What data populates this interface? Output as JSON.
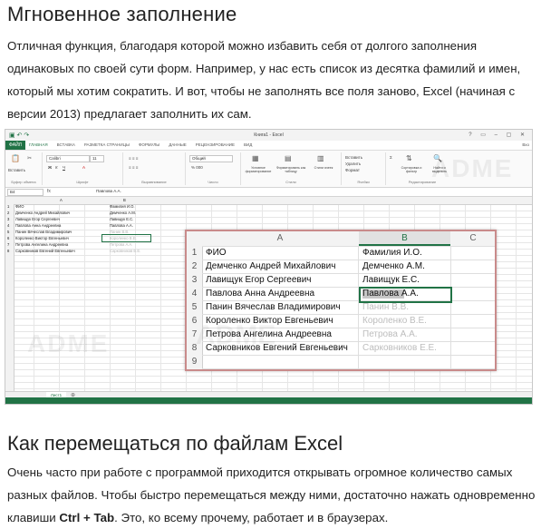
{
  "heading1": "Мгновенное заполнение",
  "para1": "Отличная функция, благодаря которой можно избавить себя от долгого заполнения одинаковых по своей сути форм. Например, у нас есть список из десятка фамилий и имен, который мы хотим сократить. И вот, чтобы не заполнять все поля заново, Excel (начиная с версии 2013) предлагает заполнить их сам.",
  "excel": {
    "window_title": "Книга1 - Excel",
    "file_tab": "ФАЙЛ",
    "tabs": [
      "ГЛАВНАЯ",
      "ВСТАВКА",
      "РАЗМЕТКА СТРАНИЦЫ",
      "ФОРМУЛЫ",
      "ДАННЫЕ",
      "РЕЦЕНЗИРОВАНИЕ",
      "ВИД"
    ],
    "user": "Вхо",
    "ribbon": {
      "paste": "Вставить",
      "font_name": "Calibri",
      "font_size": "11",
      "number_format": "Общий",
      "cond_format": "Условное форматирование",
      "format_table": "Форматировать как таблицу",
      "cell_styles": "Стили ячеек",
      "insert": "Вставить",
      "delete": "Удалить",
      "format": "Формат",
      "sort": "Сортировка и фильтр",
      "find": "Найти и выделить",
      "groups": [
        "Буфер обмена",
        "Шрифт",
        "Выравнивание",
        "Число",
        "Стили",
        "Ячейки",
        "Редактирование"
      ]
    },
    "name_box": "B4",
    "fx": "fx",
    "formula_value": "Павлова А.А.",
    "sheet_tab": "Лист1",
    "watermark": "ADME"
  },
  "table": {
    "col_a": "A",
    "col_b": "B",
    "col_c": "C",
    "rows": [
      {
        "n": "1",
        "a": "ФИО",
        "b": "Фамилия И.О.",
        "suggest": false
      },
      {
        "n": "2",
        "a": "Демченко Андрей Михайлович",
        "b": "Демченко А.М.",
        "suggest": false
      },
      {
        "n": "3",
        "a": "Лавищук Егор Сергеевич",
        "b": "Лавищук Е.С.",
        "suggest": false
      },
      {
        "n": "4",
        "a": "Павлова Анна Андреевна",
        "b": "Павлова А.А.",
        "suggest": false
      },
      {
        "n": "5",
        "a": "Панин Вячеслав Владимирович",
        "b": "Панин В.В.",
        "suggest": true
      },
      {
        "n": "6",
        "a": "Короленко Виктор Евгеньевич",
        "b": "Короленко В.Е.",
        "suggest": true
      },
      {
        "n": "7",
        "a": "Петрова Ангелина Андреевна",
        "b": "Петрова А.А.",
        "suggest": true
      },
      {
        "n": "8",
        "a": "Сарковников Евгений Евгеньевич",
        "b": "Сарковников Е.Е.",
        "suggest": true
      },
      {
        "n": "9",
        "a": "",
        "b": "",
        "suggest": false
      }
    ]
  },
  "heading2": "Как перемещаться по файлам Excel",
  "para2_start": "Очень часто при работе с программой приходится открывать огромное количество самых разных файлов. Чтобы быстро перемещаться между ними, достаточно нажать одновременно клавиши ",
  "para2_keys": "Ctrl + Tab",
  "para2_end": ". Это, ко всему прочему, работает и в браузерах."
}
